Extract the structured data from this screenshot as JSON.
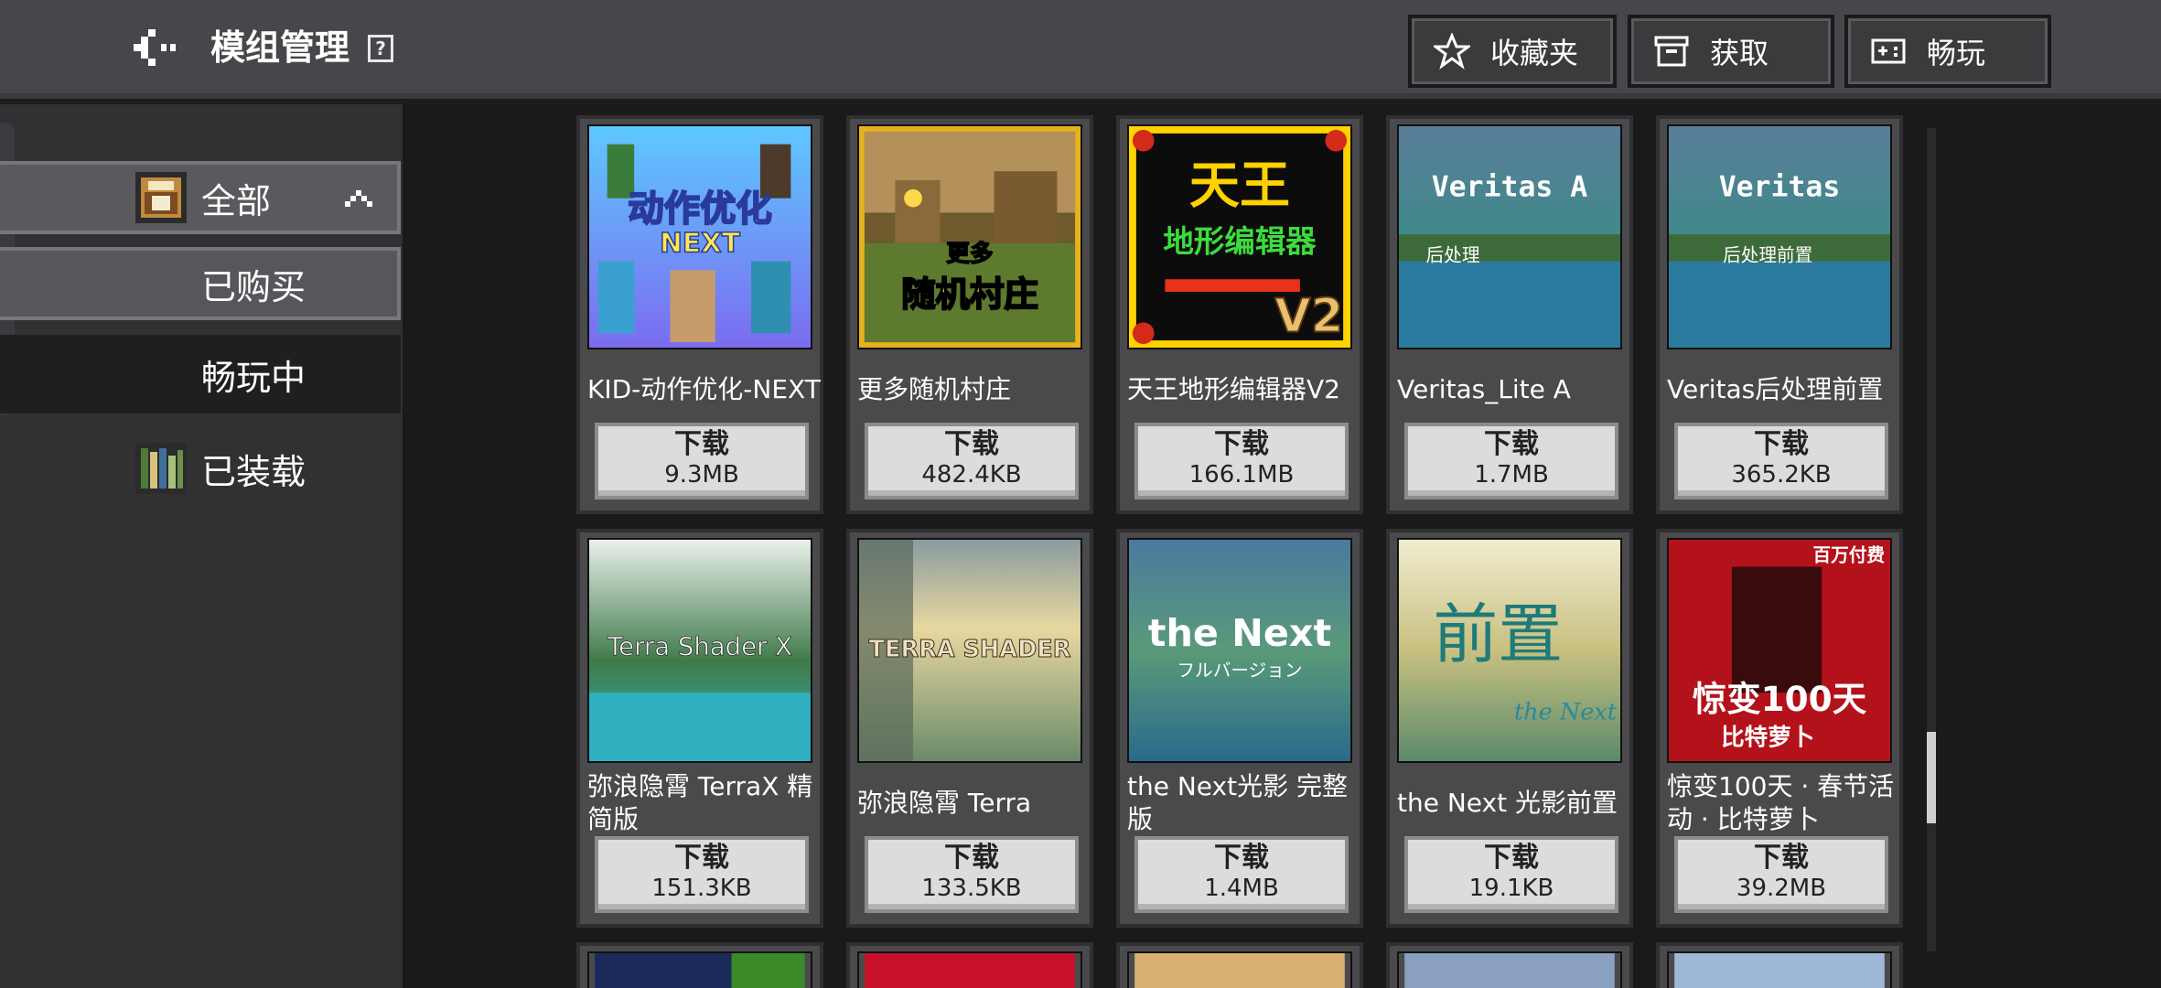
{
  "header": {
    "title": "模组管理",
    "help_label": "?",
    "buttons": [
      {
        "label": "收藏夹",
        "icon": "star-icon"
      },
      {
        "label": "获取",
        "icon": "chest-icon"
      },
      {
        "label": "畅玩",
        "icon": "gamepad-icon"
      }
    ]
  },
  "sidebar": {
    "items": [
      {
        "label": "全部",
        "icon": "all-mods-icon",
        "expanded": true
      },
      {
        "label": "已购买"
      },
      {
        "label": "畅玩中"
      },
      {
        "label": "已装载",
        "icon": "bookshelf-icon"
      }
    ]
  },
  "cards": [
    {
      "name": "KID-动作优化-NEXT",
      "button": "下载",
      "size": "9.3MB",
      "thumb_text": "动作优化 NEXT"
    },
    {
      "name": "更多随机村庄",
      "button": "下载",
      "size": "482.4KB",
      "thumb_text": "更多 随机村庄"
    },
    {
      "name": "天王地形编辑器V2",
      "button": "下载",
      "size": "166.1MB",
      "thumb_text": "天王 地形编辑器 V2"
    },
    {
      "name": "Veritas_Lite A",
      "button": "下载",
      "size": "1.7MB",
      "thumb_text": "Veritas A 后处理"
    },
    {
      "name": "Veritas后处理前置",
      "button": "下载",
      "size": "365.2KB",
      "thumb_text": "Veritas 后处理前置"
    },
    {
      "name": "弥浪隐霄 TerraX 精简版",
      "button": "下载",
      "size": "151.3KB",
      "thumb_text": "Terra Shader X"
    },
    {
      "name": "弥浪隐霄 Terra",
      "button": "下载",
      "size": "133.5KB",
      "thumb_text": "TERRA SHADER"
    },
    {
      "name": "the Next光影 完整版",
      "button": "下载",
      "size": "1.4MB",
      "thumb_text": "the Next フルバージョン"
    },
    {
      "name": "the Next 光影前置",
      "button": "下载",
      "size": "19.1KB",
      "thumb_text": "前置 the Next"
    },
    {
      "name": "惊变100天 · 春节活动 · 比特萝卜",
      "button": "下载",
      "size": "39.2MB",
      "thumb_text": "百万付费 惊变100天 比特萝卜"
    }
  ],
  "colors": {
    "topbar": "#47474b",
    "sidebar": "#313134",
    "card": "#4a4a4c",
    "button": "#dcdcdc"
  }
}
